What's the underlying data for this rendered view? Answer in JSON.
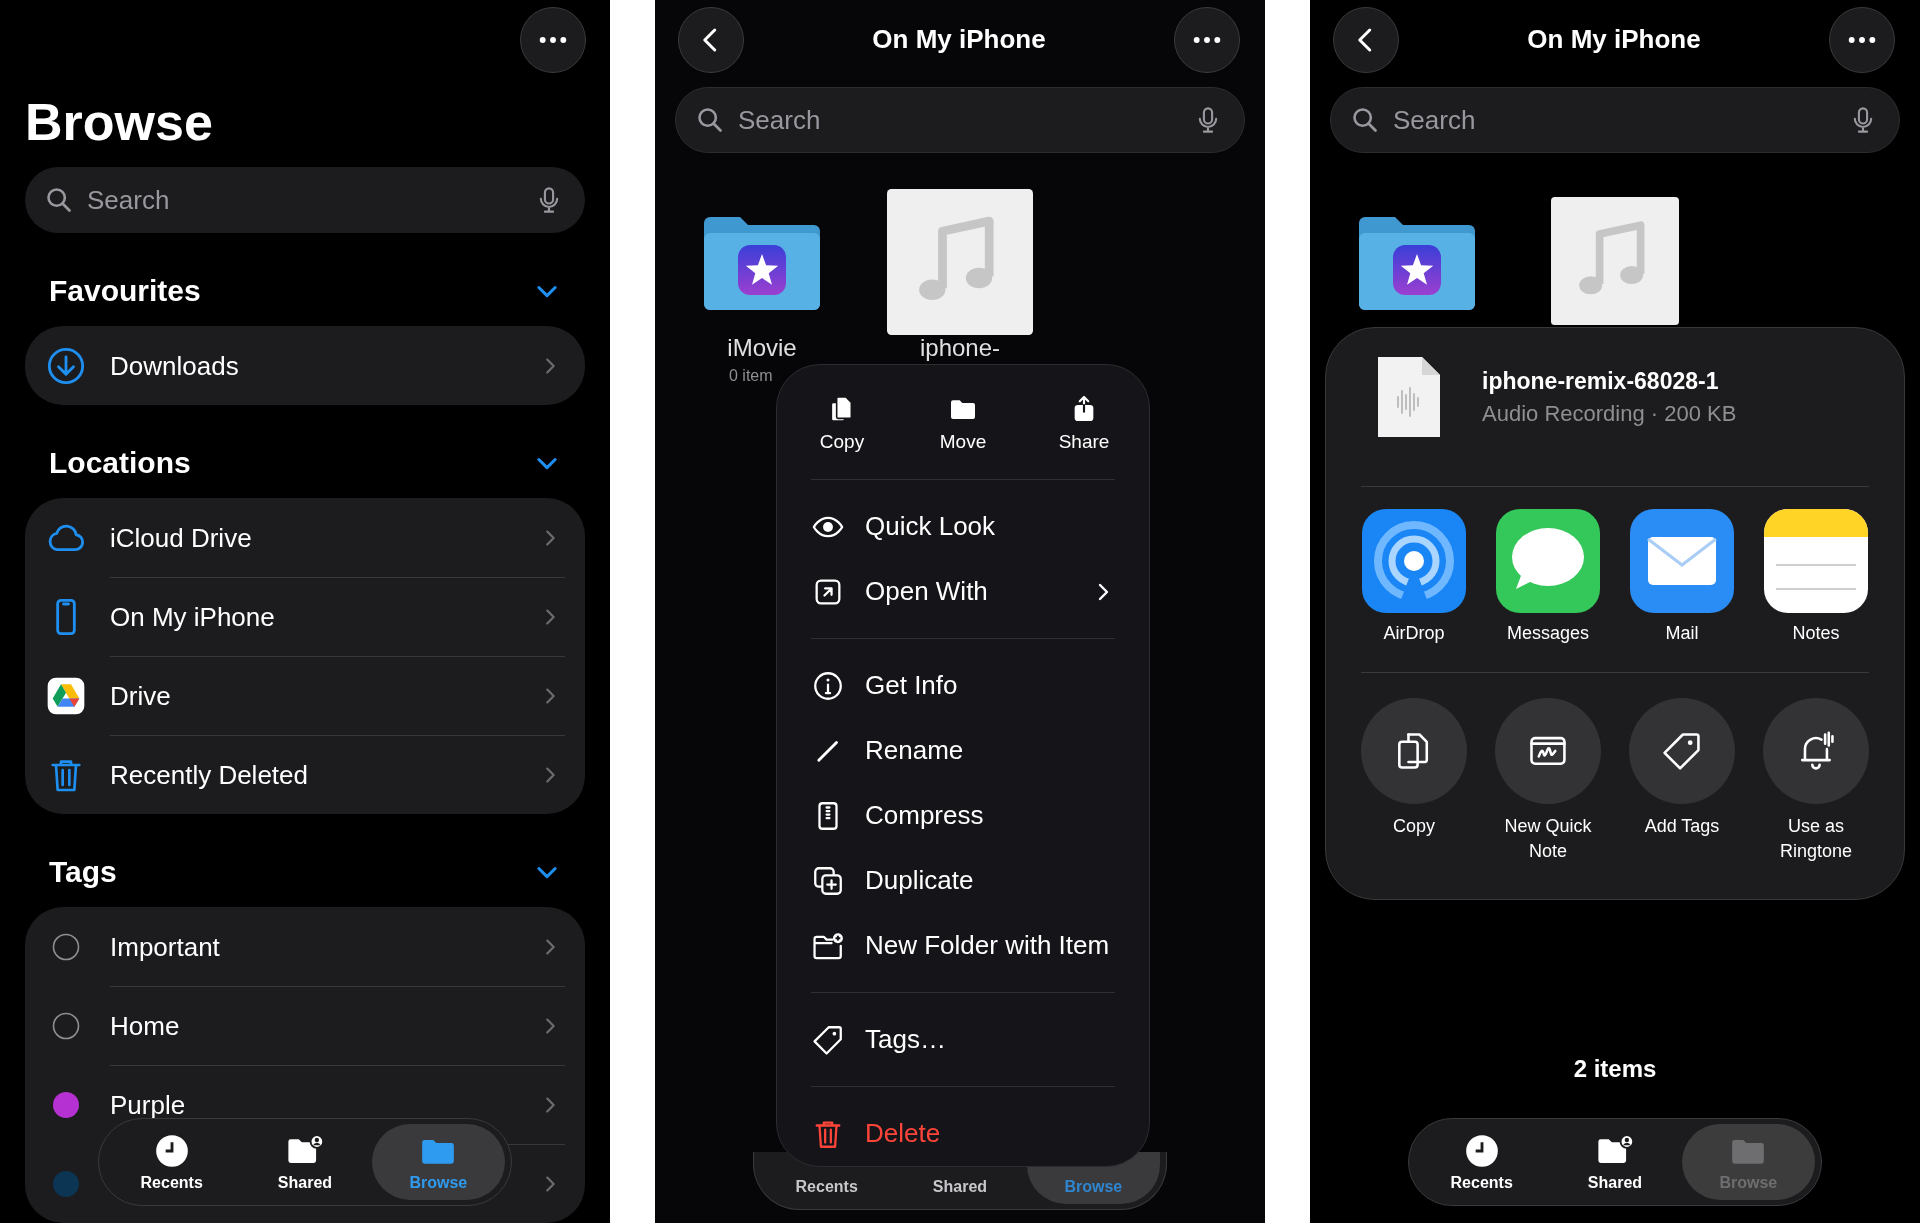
{
  "browse_screen": {
    "title": "Browse",
    "search": {
      "placeholder": "Search"
    },
    "sections": [
      {
        "kind": "favourites",
        "title": "Favourites",
        "expanded": true,
        "items": [
          {
            "label": "Downloads"
          }
        ]
      },
      {
        "kind": "locations",
        "title": "Locations",
        "expanded": true,
        "items": [
          {
            "label": "iCloud Drive"
          },
          {
            "label": "On My iPhone"
          },
          {
            "label": "Drive"
          },
          {
            "label": "Recently Deleted"
          }
        ]
      },
      {
        "kind": "tags",
        "title": "Tags",
        "expanded": true,
        "items": [
          {
            "label": "Important"
          },
          {
            "label": "Home"
          },
          {
            "label": "Purple",
            "color": "#b531d1"
          },
          {
            "color": "#0b3552"
          }
        ]
      }
    ],
    "tab_bar": {
      "dimmed": false,
      "tabs": [
        {
          "label": "Recents",
          "selected": false
        },
        {
          "label": "Shared",
          "selected": false
        },
        {
          "label": "Browse",
          "selected": true
        }
      ]
    }
  },
  "folder_screen": {
    "title": "On My iPhone",
    "search": {
      "placeholder": "Search"
    },
    "files": [
      {
        "kind": "folder",
        "name": "iMovie",
        "detail": "0 item"
      },
      {
        "kind": "audio",
        "name": "iphone-"
      }
    ],
    "context_menu": {
      "quick_actions": [
        "Copy",
        "Move",
        "Share"
      ],
      "groups": [
        [
          {
            "label": "Quick Look",
            "submenu": false,
            "destructive": false
          },
          {
            "label": "Open With",
            "submenu": true,
            "destructive": false
          }
        ],
        [
          {
            "label": "Get Info",
            "submenu": false,
            "destructive": false
          },
          {
            "label": "Rename",
            "submenu": false,
            "destructive": false
          },
          {
            "label": "Compress",
            "submenu": false,
            "destructive": false
          },
          {
            "label": "Duplicate",
            "submenu": false,
            "destructive": false
          },
          {
            "label": "New Folder with Item",
            "submenu": false,
            "destructive": false
          }
        ],
        [
          {
            "label": "Tags…",
            "submenu": false,
            "destructive": false
          }
        ],
        [
          {
            "label": "Delete",
            "submenu": false,
            "destructive": true
          }
        ]
      ]
    },
    "tab_bar": {
      "dimmed": false,
      "tabs": [
        {
          "label": "Recents",
          "selected": false
        },
        {
          "label": "Shared",
          "selected": false
        },
        {
          "label": "Browse",
          "selected": true
        }
      ]
    }
  },
  "share_screen": {
    "title": "On My iPhone",
    "search": {
      "placeholder": "Search"
    },
    "files": [
      {
        "kind": "folder"
      },
      {
        "kind": "audio"
      }
    ],
    "share_sheet": {
      "file_name": "iphone-remix-68028-1",
      "file_info": "Audio Recording · 200 KB",
      "apps": [
        {
          "label": "AirDrop"
        },
        {
          "label": "Messages"
        },
        {
          "label": "Mail"
        },
        {
          "label": "Notes"
        }
      ],
      "actions": [
        {
          "label": "Copy"
        },
        {
          "label": "New Quick Note"
        },
        {
          "label": "Add Tags"
        },
        {
          "label": "Use as Ringtone"
        }
      ]
    },
    "item_count": "2 items",
    "tab_bar": {
      "dimmed": true,
      "tabs": [
        {
          "label": "Recents",
          "selected": false
        },
        {
          "label": "Shared",
          "selected": false
        },
        {
          "label": "Browse",
          "selected": true
        }
      ]
    }
  }
}
